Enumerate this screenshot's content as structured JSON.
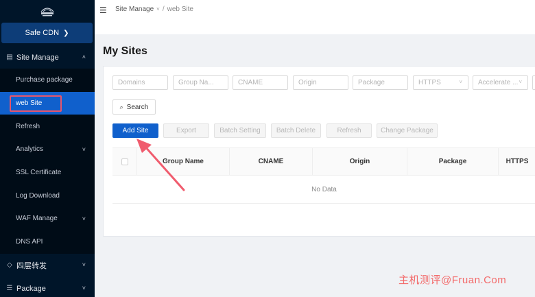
{
  "sidebar": {
    "cdn_button": "Safe CDN",
    "group_site": "Site Manage",
    "items": [
      {
        "label": "Purchase package"
      },
      {
        "label": "web Site"
      },
      {
        "label": "Refresh"
      },
      {
        "label": "Analytics"
      },
      {
        "label": "SSL Certificate"
      },
      {
        "label": "Log Download"
      },
      {
        "label": "WAF Manage"
      },
      {
        "label": "DNS API"
      }
    ],
    "group_forward": "四层转发",
    "group_package": "Package"
  },
  "breadcrumb": {
    "parent": "Site Manage",
    "current": "web Site",
    "separator": "/"
  },
  "page": {
    "title": "My Sites"
  },
  "filters": {
    "domains": "Domains",
    "group_name": "Group Na...",
    "cname": "CNAME",
    "origin": "Origin",
    "package": "Package",
    "https": "HTTPS",
    "accelerate": "Accelerate ..."
  },
  "buttons": {
    "search": "Search",
    "add_site": "Add Site",
    "export": "Export",
    "batch_setting": "Batch Setting",
    "batch_delete": "Batch Delete",
    "refresh": "Refresh",
    "change_package": "Change Package"
  },
  "table": {
    "columns": [
      "Group Name",
      "CNAME",
      "Origin",
      "Package",
      "HTTPS"
    ],
    "empty": "No Data"
  },
  "watermark": "主机测评@Fruan.Com",
  "colors": {
    "sidebar": "#001529",
    "primary": "#1060cc",
    "highlight": "#e8556b",
    "watermark": "#f36a6a"
  }
}
